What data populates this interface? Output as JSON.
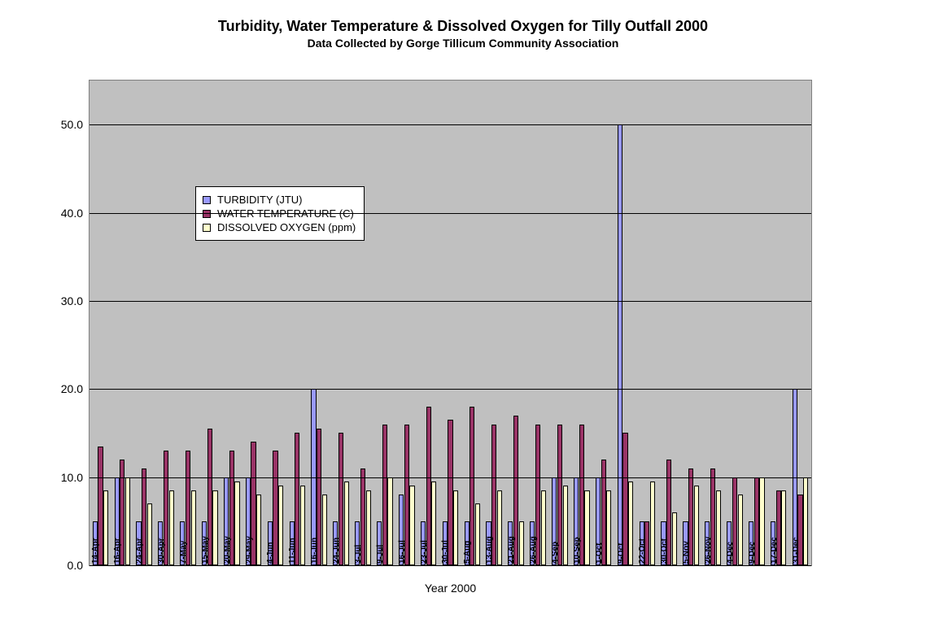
{
  "chart_data": {
    "type": "bar",
    "title": "Turbidity, Water Temperature & Dissolved Oxygen for Tilly Outfall 2000",
    "subtitle": "Data Collected by Gorge Tillicum Community Association",
    "xlabel": "Year 2000",
    "ylabel": "",
    "ylim": [
      0,
      55
    ],
    "yticks": [
      0.0,
      10.0,
      20.0,
      30.0,
      40.0,
      50.0
    ],
    "legend_position": "upper-left",
    "categories": [
      "14-Apr",
      "16-Apr",
      "24-Apr",
      "30-Apr",
      "7-May",
      "15-May",
      "20-May",
      "29-May",
      "4-Jun",
      "11-Jun",
      "16-Jun",
      "24-Jun",
      "3-Jul",
      "9-Jul",
      "16-Jul",
      "23-Jul",
      "30-Jul",
      "5-Aug",
      "13-Aug",
      "21-Aug",
      "26-Aug",
      "4-Sep",
      "10-Sep",
      "1-Oct",
      "9-Oct",
      "22-Oct",
      "30-Oct",
      "5-Nov",
      "26-Nov",
      "4-Dec",
      "9-Dec",
      "17-Dec",
      "31-Dec"
    ],
    "series": [
      {
        "name": "TURBIDITY (JTU)",
        "color": "#9999ff",
        "values": [
          5,
          10,
          5,
          5,
          5,
          5,
          10,
          10,
          5,
          5,
          20,
          5,
          5,
          5,
          8,
          5,
          5,
          5,
          5,
          5,
          5,
          10,
          10,
          10,
          50,
          5,
          5,
          5,
          5,
          5,
          5,
          5,
          20
        ]
      },
      {
        "name": "WATER TEMPERATURE (C)",
        "color": "#993366",
        "values": [
          13.5,
          12,
          11,
          13,
          13,
          15.5,
          13,
          14,
          13,
          15,
          15.5,
          15,
          11,
          16,
          16,
          18,
          16.5,
          18,
          16,
          17,
          16,
          16,
          16,
          12,
          15,
          5,
          12,
          11,
          11,
          10,
          10,
          8.5,
          8
        ]
      },
      {
        "name": "DISSOLVED OXYGEN (ppm)",
        "color": "#ffffcc",
        "values": [
          8.5,
          10,
          7,
          8.5,
          8.5,
          8.5,
          9.5,
          8,
          9,
          9,
          8,
          9.5,
          8.5,
          10,
          9,
          9.5,
          8.5,
          7,
          8.5,
          5,
          8.5,
          9,
          8.5,
          8.5,
          9.5,
          9.5,
          6,
          9,
          8.5,
          8,
          10,
          8.5,
          10
        ]
      }
    ]
  }
}
